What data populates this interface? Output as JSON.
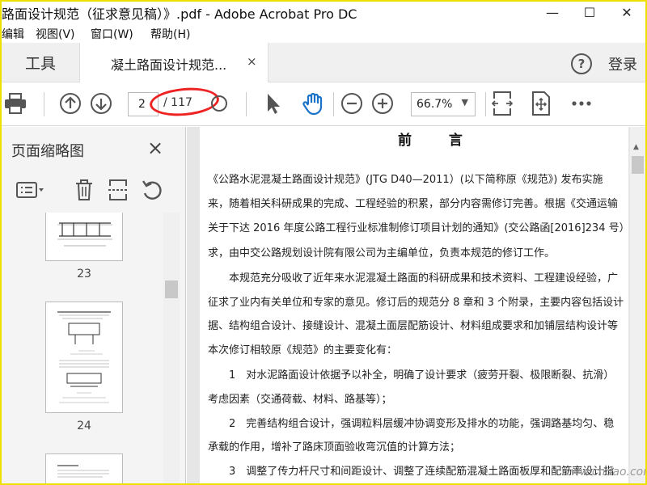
{
  "window": {
    "title": "路面设计规范（征求意见稿）》.pdf - Adobe Acrobat Pro DC",
    "min_glyph": "—",
    "max_glyph": "☐",
    "close_glyph": "✕"
  },
  "menu": [
    "编辑",
    "视图(V)",
    "窗口(W)",
    "帮助(H)"
  ],
  "tabs": {
    "tools_label": "工具",
    "doc_label": "凝土路面设计规范...",
    "close_glyph": "×",
    "help_glyph": "?",
    "login_label": "登录"
  },
  "toolbar": {
    "page_current": "2",
    "page_total": "/ 117",
    "zoom": "66.7%",
    "zoom_caret": "▼"
  },
  "panel": {
    "title": "页面缩略图",
    "close_glyph": "×",
    "thumbs": [
      {
        "label": "23"
      },
      {
        "label": "24"
      }
    ],
    "collapse_glyph": "◀"
  },
  "document": {
    "heading": "前 言",
    "lines": [
      "《公路水泥混凝土路面设计规范》(JTG D40—2011）(以下简称原《规范》) 发布实施",
      "来，随着相关科研成果的完成、工程经验的积累，部分内容需修订完善。根据《交通运输",
      "关于下达 2016 年度公路工程行业标准制修订项目计划的通知》(交公路函[2016]234 号）",
      "求，由中交公路规划设计院有限公司为主编单位，负责本规范的修订工作。",
      "　　本规范充分吸收了近年来水泥混凝土路面的科研成果和技术资料、工程建设经验，广",
      "征求了业内有关单位和专家的意见。修订后的规范分 8 章和 3 个附录，主要内容包括设计",
      "据、结构组合设计、接缝设计、混凝土面层配筋设计、材料组成要求和加铺层结构设计等",
      "本次修订相较原《规范》的主要变化有：",
      "　　1　对水泥路面设计依据予以补全，明确了设计要求（疲劳开裂、极限断裂、抗滑）",
      "考虑因素（交通荷载、材料、路基等）；",
      "　　2　完善结构组合设计，强调粒料层缓冲协调变形及排水的功能，强调路基均匀、稳",
      "承载的作用，增补了路床顶面验收弯沉值的计算方法；",
      "　　3　调整了传力杆尺寸和间距设计、调整了连续配筋混凝土路面板厚和配筋率设计指"
    ]
  },
  "watermark": "www.cndao.com",
  "colors": {
    "frame": "#f0e000",
    "hand_tool": "#1a73c8",
    "highlight": "#e22222"
  }
}
